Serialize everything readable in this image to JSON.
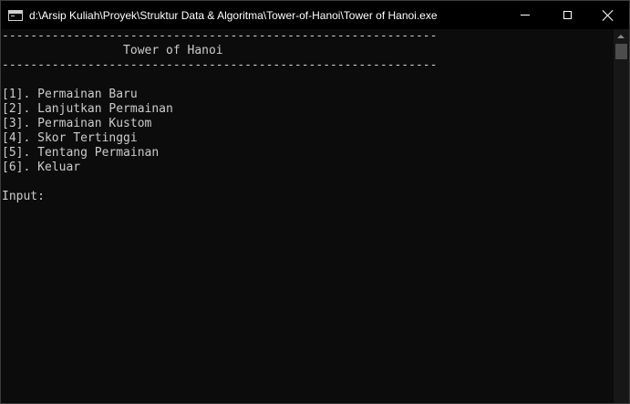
{
  "window": {
    "title": "d:\\Arsip Kuliah\\Proyek\\Struktur Data & Algoritma\\Tower-of-Hanoi\\Tower of Hanoi.exe",
    "icon": "console-app-icon",
    "controls": {
      "minimize_icon": "minimize-icon",
      "maximize_icon": "maximize-icon",
      "close_icon": "close-icon"
    }
  },
  "console": {
    "top_rule": "-------------------------------------------------------------",
    "header": "                 Tower of Hanoi",
    "bottom_rule": "-------------------------------------------------------------",
    "menu": [
      "[1]. Permainan Baru",
      "[2]. Lanjutkan Permainan",
      "[3]. Permainan Kustom",
      "[4]. Skor Tertinggi",
      "[5]. Tentang Permainan",
      "[6]. Keluar"
    ],
    "prompt": "Input:",
    "text_color": "#cccccc",
    "background_color": "#0c0c0c"
  }
}
